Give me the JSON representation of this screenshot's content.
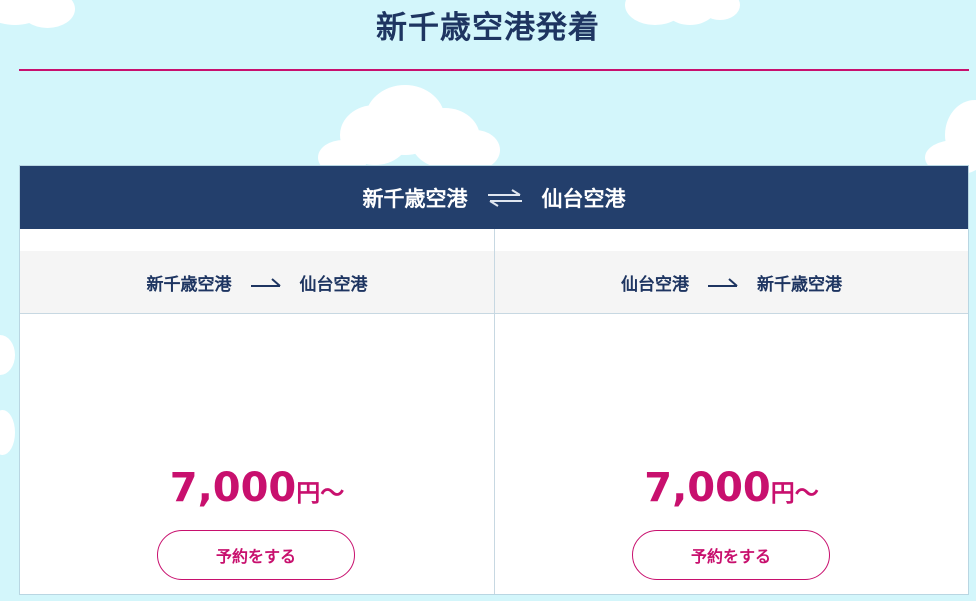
{
  "page": {
    "title": "新千歳空港発着"
  },
  "route": {
    "from": "新千歳空港",
    "to": "仙台空港",
    "swap_icon": "swap-arrows-icon"
  },
  "columns": [
    {
      "from": "新千歳空港",
      "to": "仙台空港",
      "price_value": "7,000",
      "price_suffix": "円〜",
      "button_label": "予約をする"
    },
    {
      "from": "仙台空港",
      "to": "新千歳空港",
      "price_value": "7,000",
      "price_suffix": "円〜",
      "button_label": "予約をする"
    }
  ],
  "colors": {
    "navy": "#233f6c",
    "accent": "#c8106e",
    "sky": "#d3f6fb"
  }
}
